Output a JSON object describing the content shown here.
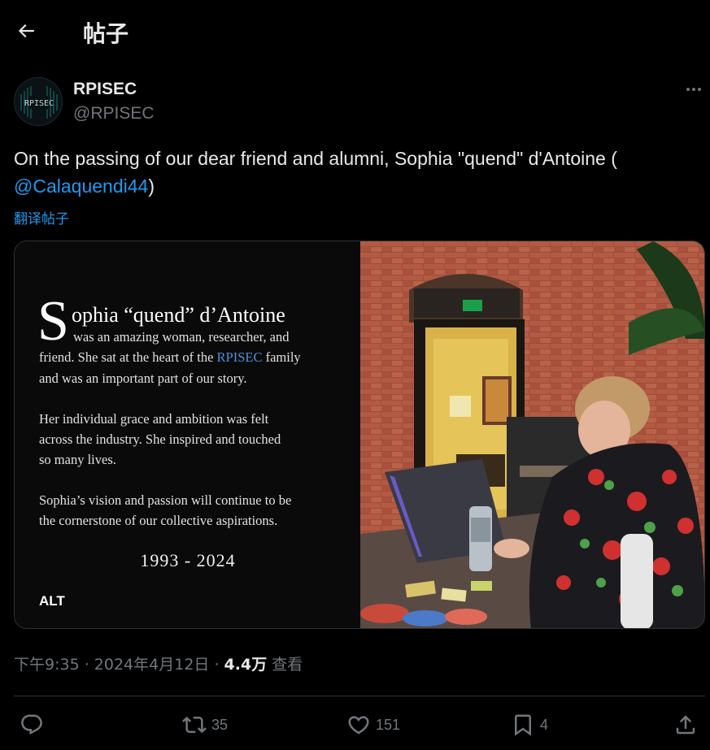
{
  "header": {
    "title": "帖子",
    "back_icon": "arrow-left-icon"
  },
  "author": {
    "display_name": "RPISEC",
    "handle": "@RPISEC",
    "avatar_text": "RPISEC"
  },
  "tweet": {
    "text_before": "On the passing of our dear friend and alumni, Sophia \"quend\" d'Antoine (",
    "mention": "@Calaquendi44",
    "text_after": ")",
    "translate_label": "翻译帖子"
  },
  "media": {
    "dropcap": "S",
    "name": "ophia “quend” d’Antoine",
    "line1": "was an amazing woman, researcher, and",
    "line2a": "friend. She sat at the heart of the ",
    "line2_highlight": "RPISEC",
    "line2b": " family",
    "line3": "and was an important part of our story.",
    "line4": "Her individual grace and ambition was felt",
    "line5": "across the industry. She inspired and touched",
    "line6": "so many lives.",
    "line7": "Sophia’s vision and passion will continue to be",
    "line8": "the cornerstone of our collective aspirations.",
    "years": "1993 - 2024",
    "alt_label": "ALT"
  },
  "meta": {
    "time": "下午9:35",
    "separator": " · ",
    "date": "2024年4月12日",
    "views": "4.4万",
    "views_label": "查看"
  },
  "actions": {
    "reply_count": "",
    "retweet_count": "35",
    "like_count": "151",
    "bookmark_count": "4"
  },
  "colors": {
    "accent": "#1d9bf0",
    "muted": "#71767b",
    "text": "#e7e9ea",
    "background": "#000000"
  }
}
